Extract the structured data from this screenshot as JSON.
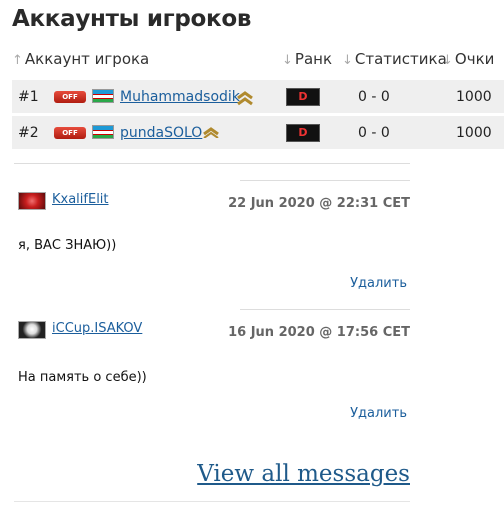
{
  "page": {
    "title": "Аккаунты игроков"
  },
  "table": {
    "headers": [
      "Аккаунт игрока",
      "Ранк",
      "Статистика",
      "Очки"
    ],
    "rows": [
      {
        "num": "#1",
        "status": "OFF",
        "name": "Muhammadsodik",
        "rank_letter": "D",
        "stats": "0 - 0",
        "points": "1000"
      },
      {
        "num": "#2",
        "status": "OFF",
        "name": "pundaSOLO",
        "rank_letter": "D",
        "stats": "0 - 0",
        "points": "1000"
      }
    ]
  },
  "comments": [
    {
      "author": "KxalifElit",
      "date": "22 Jun 2020 @ 22:31 CET",
      "text": "я, ВАС ЗНАЮ))",
      "delete_label": "Удалить"
    },
    {
      "author": "iCCup.ISAKOV",
      "date": "16 Jun 2020 @ 17:56 CET",
      "text": "На память о себе))",
      "delete_label": "Удалить"
    }
  ],
  "view_all": "View all messages",
  "colors": {
    "link": "#1b5e9c",
    "row_bg": "#efefef",
    "off_badge": "#d2301f"
  }
}
